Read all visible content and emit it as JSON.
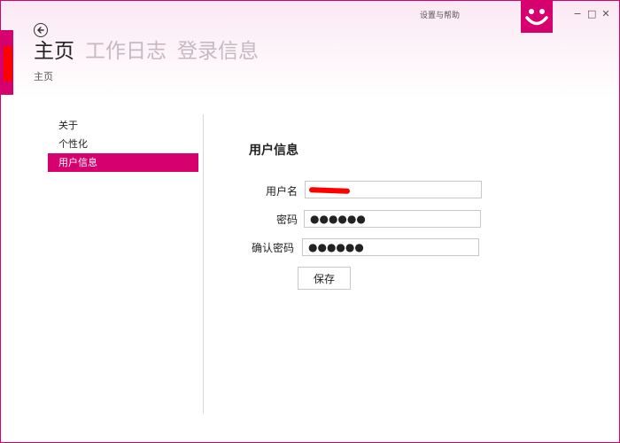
{
  "titlebar": {
    "settings_help": "设置与帮助",
    "minimize": "−",
    "maximize": "□",
    "close": "✕"
  },
  "nav": {
    "tabs": [
      {
        "label": "主页",
        "active": true
      },
      {
        "label": "工作日志",
        "active": false
      },
      {
        "label": "登录信息",
        "active": false
      }
    ],
    "breadcrumb": "主页"
  },
  "sidebar": {
    "items": [
      {
        "label": "关于",
        "selected": false
      },
      {
        "label": "个性化",
        "selected": false
      },
      {
        "label": "用户信息",
        "selected": true
      }
    ]
  },
  "form": {
    "title": "用户信息",
    "username_label": "用户名",
    "username_value": "",
    "password_label": "密码",
    "password_value": "●●●●●●",
    "confirm_label": "确认密码",
    "confirm_value": "●●●●●●",
    "save_label": "保存"
  },
  "colors": {
    "accent": "#d6006f",
    "redaction": "#ff0000"
  },
  "icons": {
    "back": "back-arrow-icon",
    "logo": "smiley-logo-icon"
  }
}
